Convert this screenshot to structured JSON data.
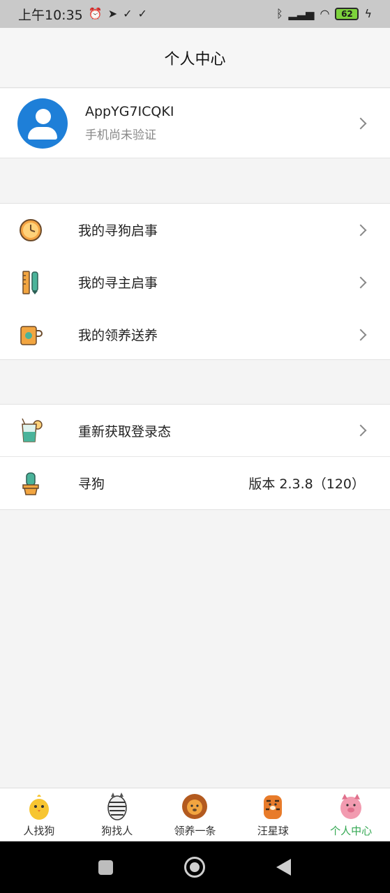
{
  "status_bar": {
    "time": "上午10:35",
    "battery": "62"
  },
  "header": {
    "title": "个人中心"
  },
  "profile": {
    "username": "AppYG7ICQKI",
    "phone_status": "手机尚未验证"
  },
  "menu_group_1": {
    "items": [
      {
        "label": "我的寻狗启事",
        "icon": "clock-icon"
      },
      {
        "label": "我的寻主启事",
        "icon": "pen-ruler-icon"
      },
      {
        "label": "我的领养送养",
        "icon": "mug-icon"
      }
    ]
  },
  "menu_group_2": {
    "items": [
      {
        "label": "重新获取登录态",
        "icon": "drink-icon"
      },
      {
        "label": "寻狗",
        "icon": "cactus-icon",
        "value": "版本 2.3.8（120）"
      }
    ]
  },
  "tab_bar": {
    "active_color": "#33a852",
    "tabs": [
      {
        "label": "人找狗",
        "icon": "chick-icon"
      },
      {
        "label": "狗找人",
        "icon": "zebra-icon"
      },
      {
        "label": "领养一条",
        "icon": "lion-icon"
      },
      {
        "label": "汪星球",
        "icon": "tiger-icon"
      },
      {
        "label": "个人中心",
        "icon": "pig-icon",
        "active": true
      }
    ]
  }
}
